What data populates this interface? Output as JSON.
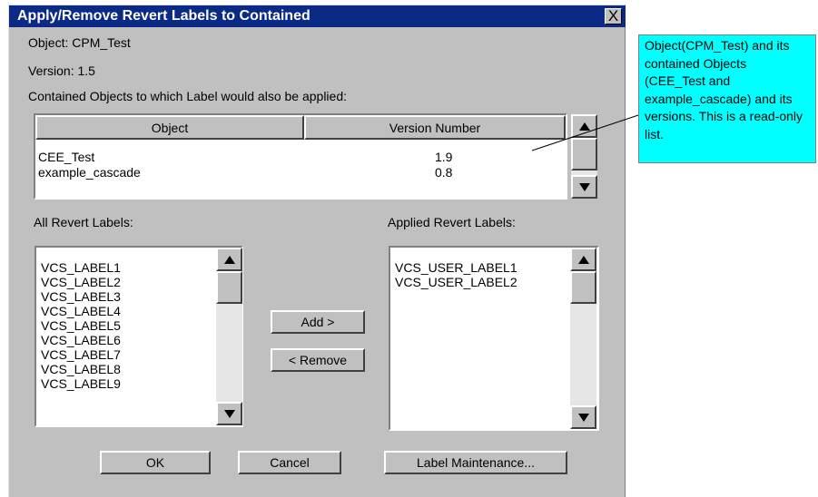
{
  "dialog": {
    "title": "Apply/Remove Revert Labels to Contained",
    "close_glyph": "X",
    "object_line": "Object: CPM_Test",
    "version_line": "Version: 1.5",
    "contained_label": "Contained Objects to which Label would also be applied:"
  },
  "contained_table": {
    "columns": [
      "Object",
      "Version Number"
    ],
    "rows": [
      {
        "object": "CEE_Test",
        "version": "1.9"
      },
      {
        "object": "example_cascade",
        "version": "0.8"
      }
    ]
  },
  "all_labels": {
    "heading": "All Revert  Labels:",
    "items": [
      "VCS_LABEL1",
      "VCS_LABEL2",
      "VCS_LABEL3",
      "VCS_LABEL4",
      "VCS_LABEL5",
      "VCS_LABEL6",
      "VCS_LABEL7",
      "VCS_LABEL8",
      "VCS_LABEL9"
    ]
  },
  "applied_labels": {
    "heading": "Applied Revert Labels:",
    "items": [
      "VCS_USER_LABEL1",
      "VCS_USER_LABEL2"
    ]
  },
  "buttons": {
    "add": "Add >",
    "remove": "< Remove",
    "ok": "OK",
    "cancel": "Cancel",
    "maintenance": "Label Maintenance..."
  },
  "callout": {
    "text": "Object(CPM_Test) and its contained Objects (CEE_Test and example_cascade) and its versions. This is a read-only list."
  },
  "colors": {
    "titlebar": "#0a2a85",
    "dialog_bg": "#c0c0c0",
    "callout_bg": "#00ffff"
  }
}
